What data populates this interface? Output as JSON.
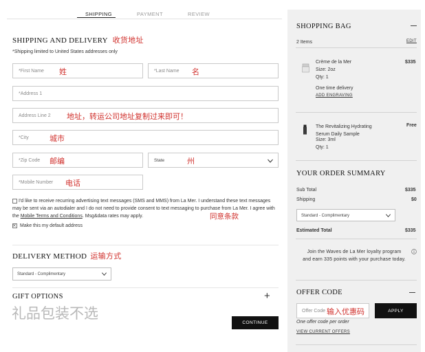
{
  "tabs": [
    {
      "label": "SHIPPING",
      "active": true
    },
    {
      "label": "PAYMENT",
      "active": false
    },
    {
      "label": "REVIEW",
      "active": false
    }
  ],
  "shipping": {
    "title": "SHIPPING AND DELIVERY",
    "title_note_cn": "收货地址",
    "limit_note": "*Shipping limited to United States addresses only",
    "first_name": {
      "placeholder": "*First Name",
      "note_cn": "姓"
    },
    "last_name": {
      "placeholder": "*Last Name",
      "note_cn": "名"
    },
    "address1": {
      "placeholder": "*Address 1"
    },
    "address2": {
      "placeholder": "Address Line 2",
      "note_cn": "地址，转运公司地址复制过来即可！"
    },
    "city": {
      "placeholder": "*City",
      "note_cn": "城市"
    },
    "zip": {
      "placeholder": "*Zip Code",
      "note_cn": "邮编"
    },
    "state": {
      "placeholder": "State",
      "note_cn": "州"
    },
    "mobile": {
      "placeholder": "*Mobile Number",
      "note_cn": "电话"
    },
    "consent_text_1": "I'd like to receive recurring advertising text messages (SMS and MMS) from La Mer. I understand these text messages may be sent via an autodialer and I do not need to provide consent to text messaging to purchase from La Mer. I agree with the ",
    "consent_link": "Mobile Terms and Conditions",
    "consent_text_2": ". Msg&data rates may apply.",
    "consent_note_cn": "同意条款",
    "default_address_label": "Make this my default address"
  },
  "delivery": {
    "title": "DELIVERY METHOD",
    "title_note_cn": "运输方式",
    "selected": "Standard - Complimentary"
  },
  "gift": {
    "title": "GIFT OPTIONS",
    "note_cn": "礼品包装不选",
    "toggle_symbol": "+"
  },
  "continue_label": "CONTINUE",
  "bag": {
    "title": "SHOPPING BAG",
    "count": "2 Items",
    "edit": "EDIT",
    "items": [
      {
        "name": "Crème de la Mer",
        "size": "Size: 2oz",
        "qty": "Qty: 1",
        "price": "$335",
        "delivery": "One time delivery",
        "engraving": "ADD ENGRAVING"
      },
      {
        "name": "The Revitalizing Hydrating Serum Daily Sample",
        "size": "Size: 3ml",
        "qty": "Qty: 1",
        "price": "Free"
      }
    ]
  },
  "summary": {
    "title": "YOUR ORDER SUMMARY",
    "subtotal_label": "Sub Total",
    "subtotal": "$335",
    "shipping_label": "Shipping",
    "shipping": "$0",
    "shipping_method": "Standard - Complimentary",
    "total_label": "Estimated Total",
    "total": "$335",
    "loyalty": "Join the Waves de La Mer loyalty program and earn 335 points with your purchase today."
  },
  "offer": {
    "title": "OFFER CODE",
    "placeholder": "Offer Code",
    "note_cn": "输入优惠码",
    "apply": "APPLY",
    "limit": "One offer code per order",
    "view_link": "VIEW CURRENT OFFERS"
  },
  "colors": {
    "accent": "#d0312d",
    "dark": "#111111",
    "panel": "#f0f0f0"
  }
}
